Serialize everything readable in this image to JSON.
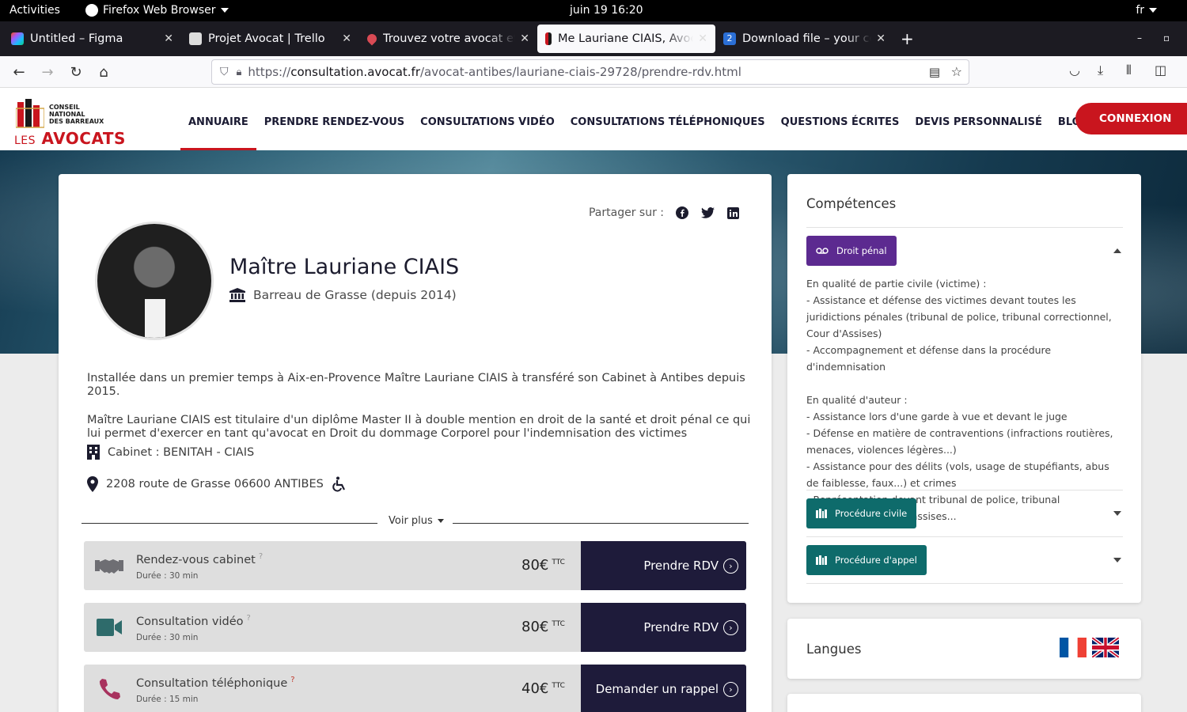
{
  "system": {
    "activities": "Activities",
    "app_name": "Firefox Web Browser",
    "clock": "juin 19  16:20",
    "input_lang": "fr"
  },
  "tabs": [
    {
      "title": "Untitled – Figma",
      "icon": "figma-icon"
    },
    {
      "title": "Projet Avocat | Trello",
      "icon": "trello-icon"
    },
    {
      "title": "Trouvez votre avocat et c",
      "icon": "map-pin-icon"
    },
    {
      "title": "Me Lauriane CIAIS, Avoca",
      "icon": "avocats-icon",
      "active": true
    },
    {
      "title": "Download file – your con",
      "icon": "download-file-icon"
    }
  ],
  "url": {
    "scheme": "https://",
    "host": "consultation.avocat.fr",
    "path": "/avocat-antibes/lauriane-ciais-29728/prendre-rdv.html"
  },
  "site": {
    "logo_line1": "CONSEIL NATIONAL",
    "logo_line2": "DES BARREAUX",
    "logo_les": "LES",
    "logo_avocats": "AVOCATS",
    "nav": [
      "ANNUAIRE",
      "PRENDRE RENDEZ-VOUS",
      "CONSULTATIONS VIDÉO",
      "CONSULTATIONS TÉLÉPHONIQUES",
      "QUESTIONS ÉCRITES",
      "DEVIS PERSONNALISÉ",
      "BLOGS DES AVOCATS"
    ],
    "login": "CONNEXION",
    "brand_red": "#c9151e",
    "brand_navy": "#1e1b3a"
  },
  "profile": {
    "share_label": "Partager sur :",
    "name": "Maître Lauriane CIAIS",
    "bar": "Barreau de Grasse (depuis 2014)",
    "bio1": "Installée dans un premier temps à Aix-en-Provence Maître Lauriane CIAIS à transféré son Cabinet à Antibes depuis 2015.",
    "bio2": "Maître Lauriane CIAIS est titulaire d'un diplôme Master II à double mention en droit de la santé et droit pénal ce qui lui permet d'exercer en tant qu'avocat en Droit du dommage Corporel pour l'indemnisation des victimes d'agression,...",
    "cabinet": "Cabinet : BENITAH - CIAIS",
    "address": "2208 route de Grasse 06600 ANTIBES",
    "see_more": "Voir plus"
  },
  "services": [
    {
      "name": "Rendez-vous cabinet",
      "duration": "Durée : 30 min",
      "price": "80€",
      "tax": "TTC",
      "cta": "Prendre RDV",
      "icon": "handshake-icon"
    },
    {
      "name": "Consultation vidéo",
      "duration": "Durée : 30 min",
      "price": "80€",
      "tax": "TTC",
      "cta": "Prendre RDV",
      "icon": "video-camera-icon"
    },
    {
      "name": "Consultation téléphonique",
      "duration": "Durée : 15 min",
      "price": "40€",
      "tax": "TTC",
      "cta": "Demander un rappel",
      "icon": "phone-icon"
    }
  ],
  "competences": {
    "title": "Compétences",
    "items": [
      {
        "label": "Droit pénal",
        "expanded": true,
        "color": "#5c2a90"
      },
      {
        "label": "Procédure civile",
        "expanded": false,
        "color": "#0e6b6b"
      },
      {
        "label": "Procédure d'appel",
        "expanded": false,
        "color": "#0e6b6b"
      }
    ],
    "details": [
      "En qualité de partie civile (victime) :",
      "- Assistance et défense des victimes devant toutes les juridictions pénales (tribunal de police, tribunal correctionnel, Cour d'Assises)",
      "- Accompagnement et défense dans la procédure d'indemnisation",
      "",
      "En qualité d'auteur :",
      "- Assistance lors d'une garde à vue et devant le juge",
      "- Défense en matière de contraventions (infractions routières, menaces, violences légères...)",
      "- Assistance pour des délits (vols, usage de stupéfiants, abus de faiblesse, faux...) et crimes",
      "- Représentation devant tribunal de police, tribunal correctionnel, cour d'assises..."
    ]
  },
  "languages": {
    "title": "Langues",
    "flags": [
      "france-flag-icon",
      "uk-flag-icon"
    ]
  }
}
